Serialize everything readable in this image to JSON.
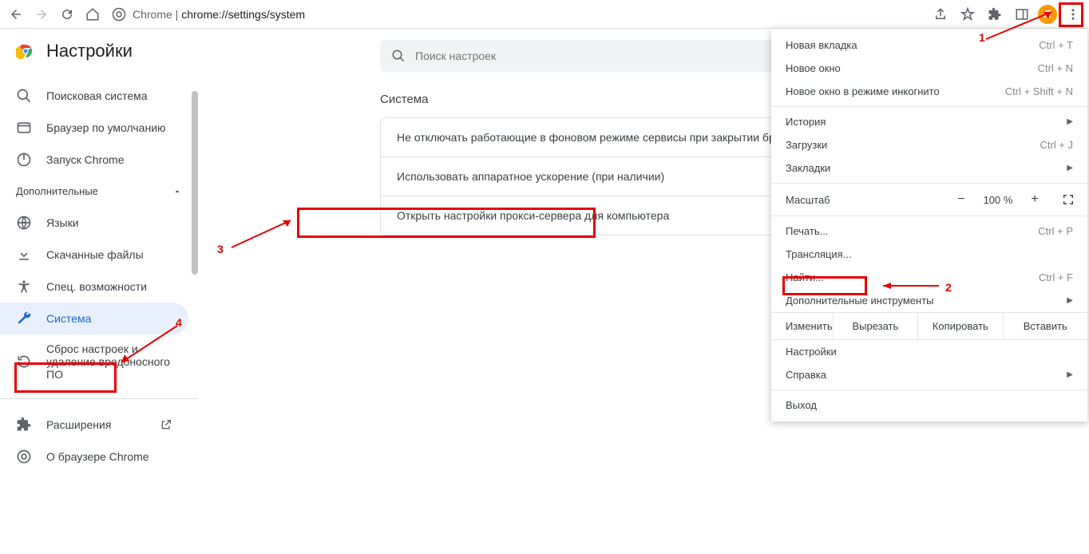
{
  "url": {
    "prefix": "Chrome | ",
    "path": "chrome://settings/system"
  },
  "avatar_letter": "Л",
  "settings_title": "Настройки",
  "search": {
    "placeholder": "Поиск настроек"
  },
  "sidebar": {
    "items": [
      {
        "label": "Поисковая система"
      },
      {
        "label": "Браузер по умолчанию"
      },
      {
        "label": "Запуск Chrome"
      }
    ],
    "advanced_header": "Дополнительные",
    "advanced_items": [
      {
        "label": "Языки"
      },
      {
        "label": "Скачанные файлы"
      },
      {
        "label": "Спец. возможности"
      },
      {
        "label": "Система"
      },
      {
        "label": "Сброс настроек и удаление вредоносного ПО"
      }
    ],
    "bottom_items": [
      {
        "label": "Расширения"
      },
      {
        "label": "О браузере Chrome"
      }
    ]
  },
  "main": {
    "section_title": "Система",
    "rows": [
      "Не отключать работающие в фоновом режиме сервисы при закрытии браузера",
      "Использовать аппаратное ускорение (при наличии)",
      "Открыть настройки прокси-сервера для компьютера"
    ]
  },
  "menu": {
    "new_tab": "Новая вкладка",
    "new_tab_sc": "Ctrl + T",
    "new_window": "Новое окно",
    "new_window_sc": "Ctrl + N",
    "incognito": "Новое окно в режиме инкогнито",
    "incognito_sc": "Ctrl + Shift + N",
    "history": "История",
    "downloads": "Загрузки",
    "downloads_sc": "Ctrl + J",
    "bookmarks": "Закладки",
    "zoom_label": "Масштаб",
    "zoom_value": "100 %",
    "print": "Печать...",
    "print_sc": "Ctrl + P",
    "cast": "Трансляция...",
    "find": "Найти...",
    "find_sc": "Ctrl + F",
    "tools": "Дополнительные инструменты",
    "edit_label": "Изменить",
    "cut": "Вырезать",
    "copy": "Копировать",
    "paste": "Вставить",
    "settings": "Настройки",
    "help": "Справка",
    "exit": "Выход"
  },
  "annotations": {
    "n1": "1",
    "n2": "2",
    "n3": "3",
    "n4": "4"
  }
}
